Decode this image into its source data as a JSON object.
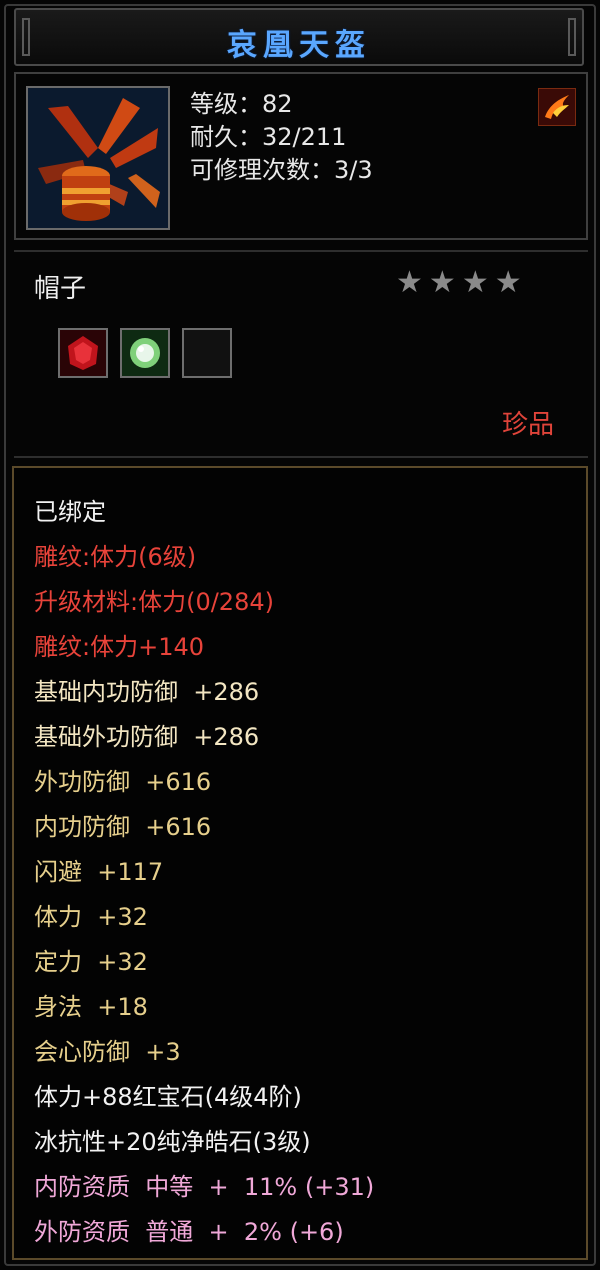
{
  "title": "哀凰天盔",
  "header": {
    "level": "等级：82",
    "durability": "耐久：32/211",
    "repair": "可修理次数：3/3",
    "corner_icon": "phoenix-icon"
  },
  "item_type": "帽子",
  "stars": {
    "filled": 0,
    "total": 4
  },
  "gems": [
    {
      "name": "red-gem-icon",
      "color": "#c0141c"
    },
    {
      "name": "green-gem-icon",
      "color": "#7fd07a"
    },
    {
      "name": "empty-socket-icon",
      "color": "#111111"
    }
  ],
  "quality": "珍品",
  "lines": [
    {
      "text": "已绑定",
      "color": "white"
    },
    {
      "text": "雕纹:体力(6级)",
      "color": "red"
    },
    {
      "text": "升级材料:体力(0/284)",
      "color": "red"
    },
    {
      "text": "雕纹:体力+140",
      "color": "red"
    },
    {
      "text": "基础内功防御  +286",
      "color": "beige"
    },
    {
      "text": "基础外功防御  +286",
      "color": "beige"
    },
    {
      "text": "外功防御  +616",
      "color": "gold"
    },
    {
      "text": "内功防御  +616",
      "color": "gold"
    },
    {
      "text": "闪避  +117",
      "color": "gold"
    },
    {
      "text": "体力  +32",
      "color": "gold"
    },
    {
      "text": "定力  +32",
      "color": "gold"
    },
    {
      "text": "身法  +18",
      "color": "gold"
    },
    {
      "text": "会心防御  +3",
      "color": "gold"
    },
    {
      "text": "体力+88红宝石(4级4阶)",
      "color": "white"
    },
    {
      "text": "冰抗性+20纯净皓石(3级)",
      "color": "white"
    },
    {
      "text": "内防资质  中等  +  11% (+31)",
      "color": "pink"
    },
    {
      "text": "外防资质  普通  +  2% (+6)",
      "color": "pink"
    }
  ]
}
